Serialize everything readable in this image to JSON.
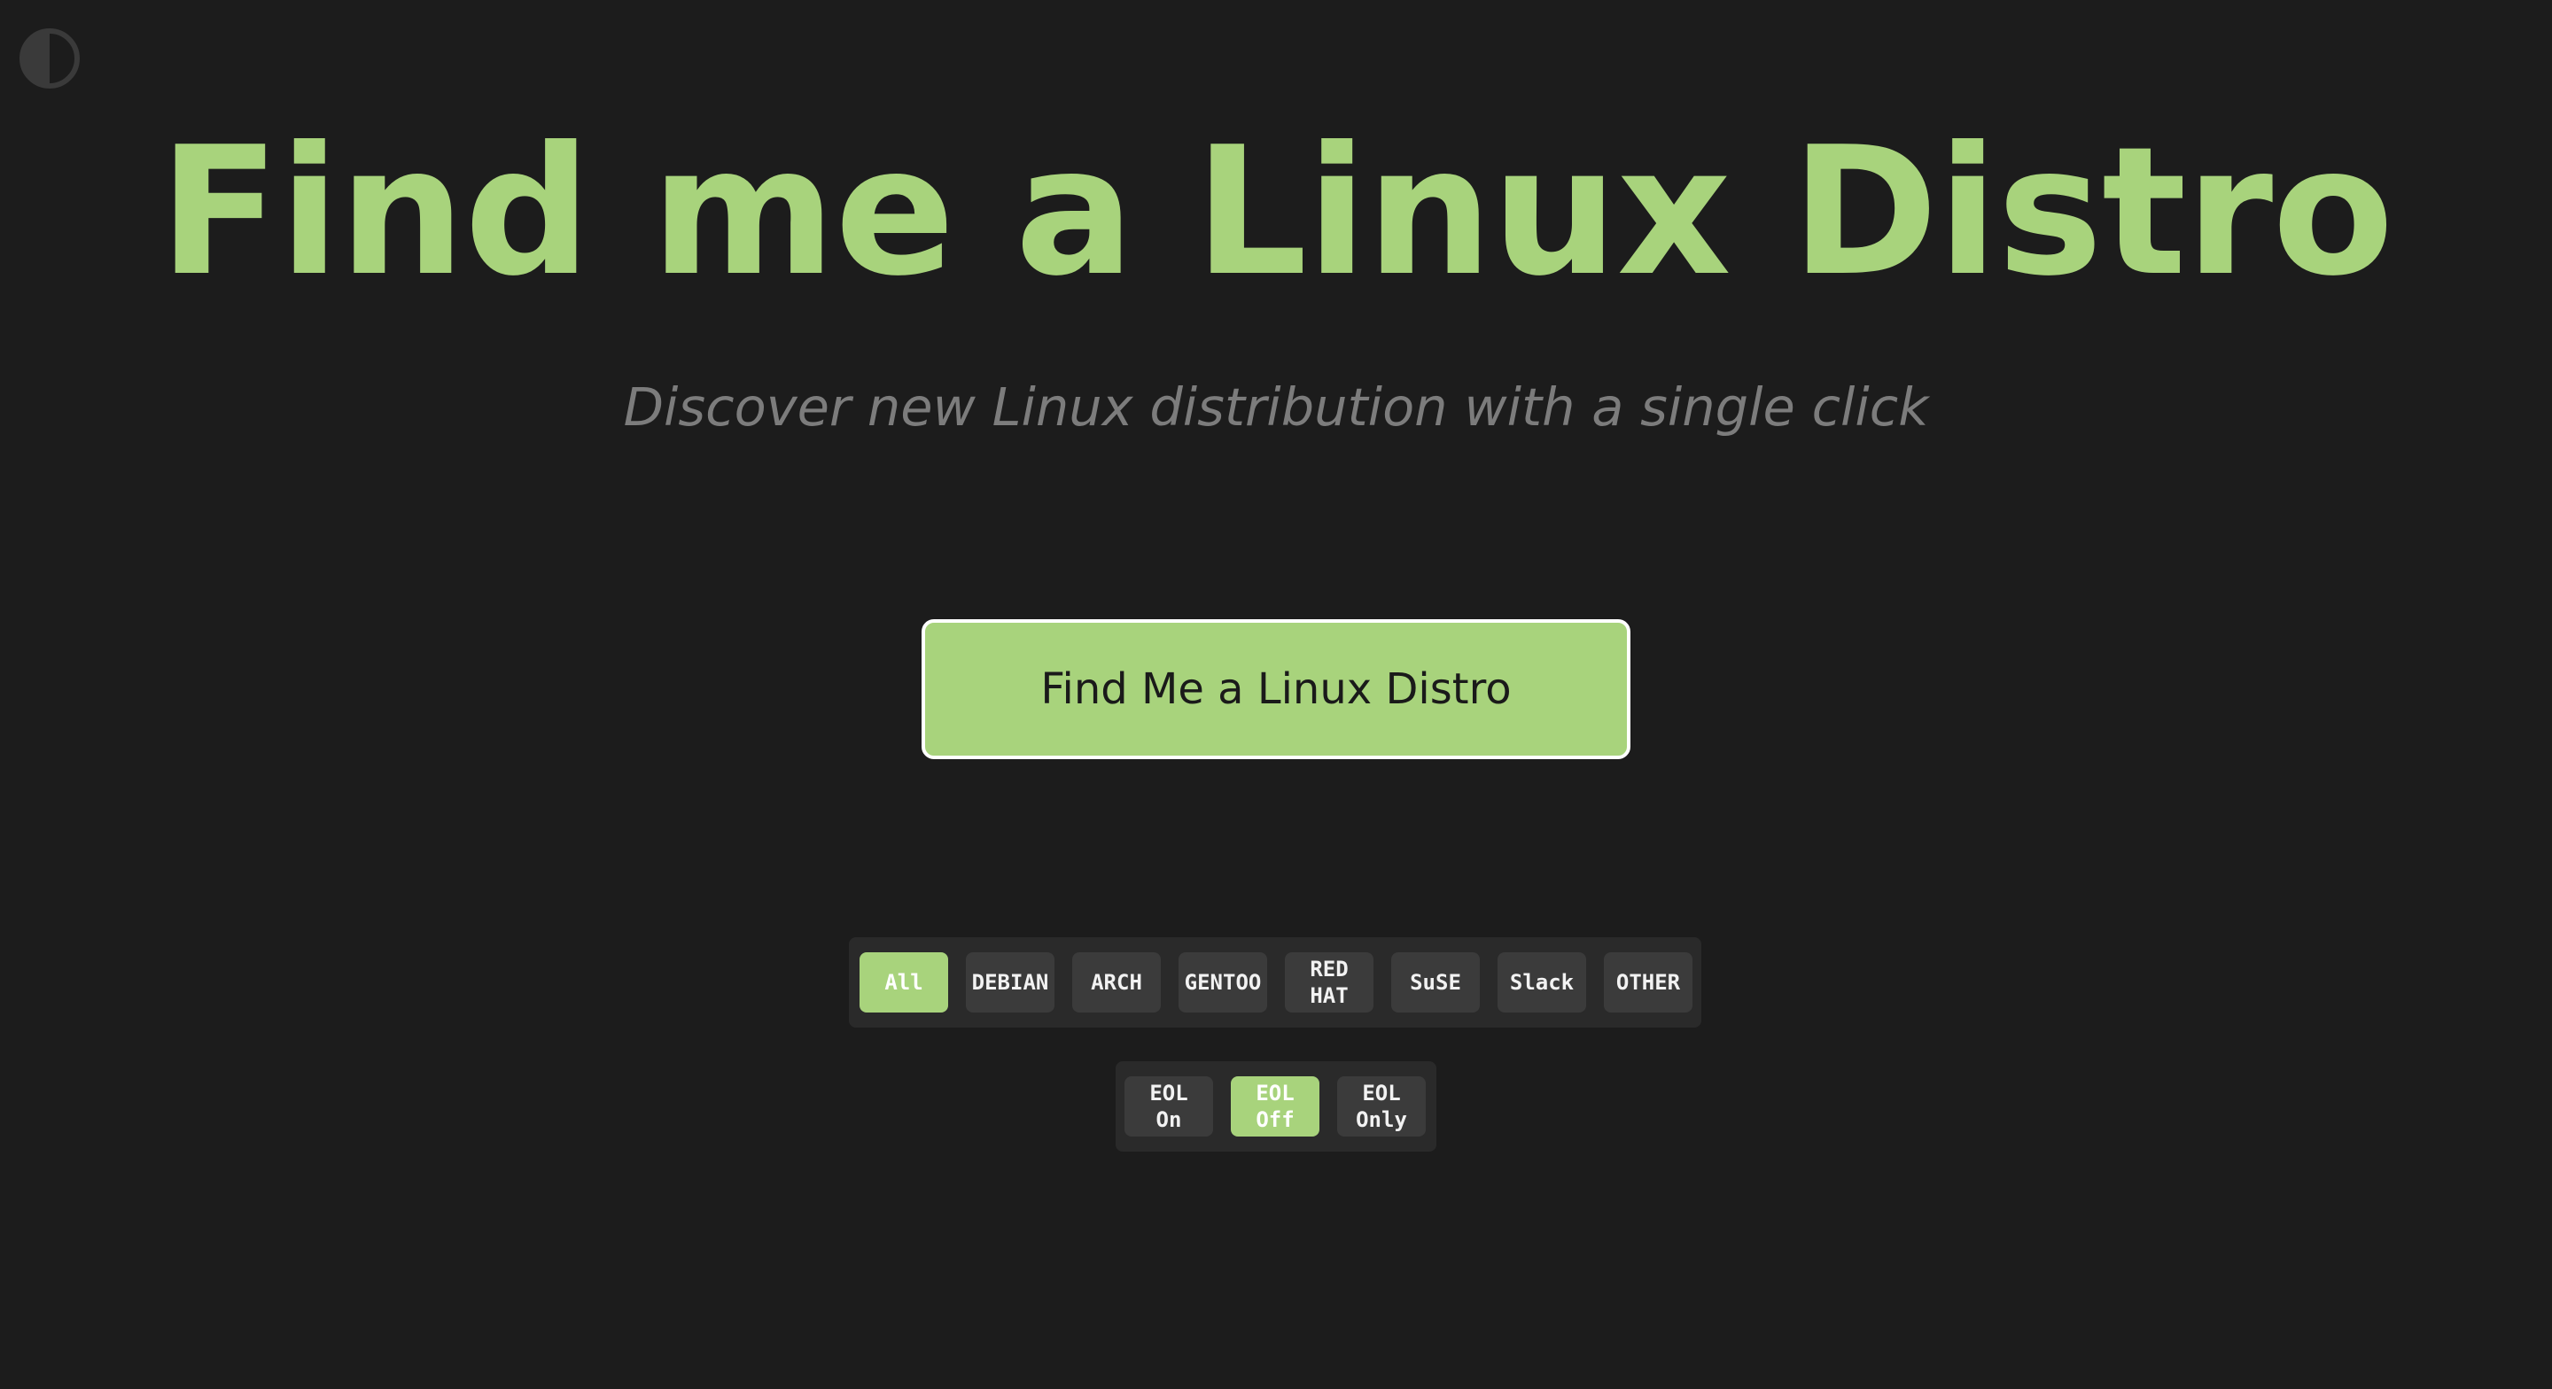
{
  "theme_toggle": {
    "icon": "half-circle-contrast-icon",
    "color": "#3a3a3a"
  },
  "header": {
    "title": "Find me a Linux Distro",
    "subtitle": "Discover new Linux distribution with a single click"
  },
  "main_button": {
    "label": "Find Me a Linux Distro"
  },
  "family_filters": {
    "items": [
      {
        "label": "All",
        "active": true
      },
      {
        "label": "DEBIAN",
        "active": false
      },
      {
        "label": "ARCH",
        "active": false
      },
      {
        "label": "GENTOO",
        "active": false
      },
      {
        "label": "RED\nHAT",
        "active": false
      },
      {
        "label": "SuSE",
        "active": false
      },
      {
        "label": "Slack",
        "active": false
      },
      {
        "label": "OTHER",
        "active": false
      }
    ]
  },
  "eol_filters": {
    "items": [
      {
        "label": "EOL\nOn",
        "active": false
      },
      {
        "label": "EOL\nOff",
        "active": true
      },
      {
        "label": "EOL\nOnly",
        "active": false
      }
    ]
  },
  "colors": {
    "background": "#1c1c1c",
    "accent": "#a8d37c",
    "subtitle": "#7c7c7c",
    "chip": "#3b3b3b",
    "group_bg": "#2a2a2a"
  }
}
